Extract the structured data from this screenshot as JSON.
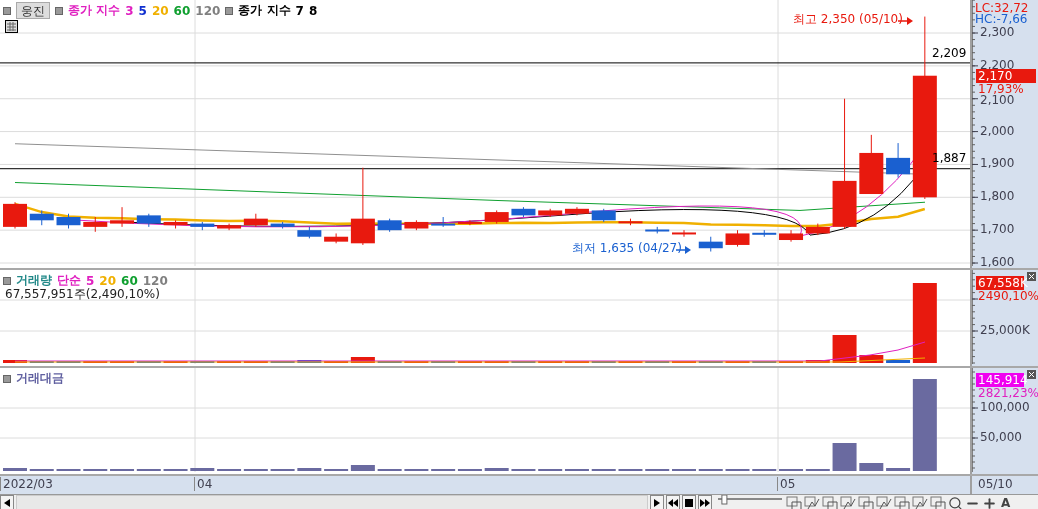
{
  "stock_button": {
    "label": "웅진"
  },
  "price_legend": [
    {
      "text": "종가 지수",
      "color": "#e020c0"
    },
    {
      "text": "3",
      "color": "#e020c0"
    },
    {
      "text": "5",
      "color": "#1030d0"
    },
    {
      "text": "20",
      "color": "#f0b000"
    },
    {
      "text": "60",
      "color": "#10a030"
    },
    {
      "text": "120",
      "color": "#808080"
    }
  ],
  "price_legend_2": [
    {
      "text": "종가 지수",
      "color": "#000000"
    },
    {
      "text": "7",
      "color": "#000000"
    },
    {
      "text": "8",
      "color": "#000000"
    }
  ],
  "annotations": {
    "high": "최고 2,350 (05/10)",
    "low": "최저 1,635 (04/27)"
  },
  "lines": [
    {
      "label": "2,209"
    },
    {
      "label": "1,887"
    }
  ],
  "price_axis": {
    "lc": "LC:32,72",
    "hc": "HC:-7,66",
    "ticks": [
      "2,300",
      "2,200",
      "2,100",
      "2,000",
      "1,900",
      "1,800",
      "1,700",
      "1,600"
    ],
    "current": "2,170",
    "change": "17,93%"
  },
  "volume": {
    "legend": [
      {
        "text": "거래량",
        "color": "#208888"
      },
      {
        "text": "단순",
        "color": "#e020c0"
      },
      {
        "text": "5",
        "color": "#e020c0"
      },
      {
        "text": "20",
        "color": "#f0b000"
      },
      {
        "text": "60",
        "color": "#10a030"
      },
      {
        "text": "120",
        "color": "#808080"
      }
    ],
    "total": "67,557,951주(2,490,10%)",
    "axis": {
      "current": "67,558K",
      "change": "2490,10%",
      "ticks": [
        "25,000K"
      ]
    }
  },
  "amount": {
    "legend": [
      {
        "text": "거래대금",
        "color": "#6060a0"
      }
    ],
    "axis": {
      "current": "145,914",
      "change": "2821,23%",
      "ticks": [
        "100,000",
        "50,000"
      ]
    }
  },
  "dates": [
    "2022/03",
    "04",
    "05"
  ],
  "last_date": "05/10",
  "toolbar": {
    "font_button": "A",
    "speed_slider": {
      "level": 0.1
    }
  }
}
